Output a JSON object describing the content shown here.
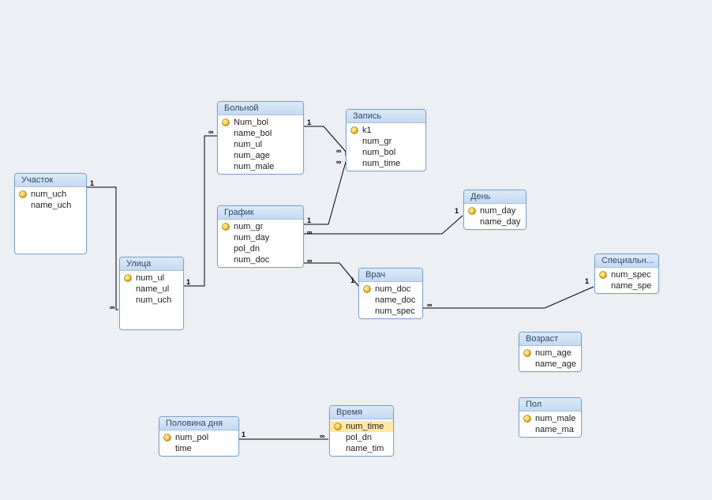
{
  "tables": {
    "uchastok": {
      "title": "Участок",
      "fields": [
        {
          "name": "num_uch",
          "pk": true
        },
        {
          "name": "name_uch",
          "pk": false
        }
      ]
    },
    "ulica": {
      "title": "Улица",
      "fields": [
        {
          "name": "num_ul",
          "pk": true
        },
        {
          "name": "name_ul",
          "pk": false
        },
        {
          "name": "num_uch",
          "pk": false
        }
      ]
    },
    "bolnoy": {
      "title": "Больной",
      "fields": [
        {
          "name": "Num_bol",
          "pk": true
        },
        {
          "name": "name_bol",
          "pk": false
        },
        {
          "name": "num_ul",
          "pk": false
        },
        {
          "name": "num_age",
          "pk": false
        },
        {
          "name": "num_male",
          "pk": false
        }
      ]
    },
    "grafik": {
      "title": "График",
      "fields": [
        {
          "name": "num_gr",
          "pk": true
        },
        {
          "name": "num_day",
          "pk": false
        },
        {
          "name": "pol_dn",
          "pk": false
        },
        {
          "name": "num_doc",
          "pk": false
        }
      ]
    },
    "zapis": {
      "title": "Запись",
      "fields": [
        {
          "name": "k1",
          "pk": true
        },
        {
          "name": "num_gr",
          "pk": false
        },
        {
          "name": "num_bol",
          "pk": false
        },
        {
          "name": "num_time",
          "pk": false
        }
      ]
    },
    "den": {
      "title": "День",
      "fields": [
        {
          "name": "num_day",
          "pk": true
        },
        {
          "name": "name_day",
          "pk": false
        }
      ]
    },
    "vrach": {
      "title": "Врач",
      "fields": [
        {
          "name": "num_doc",
          "pk": true
        },
        {
          "name": "name_doc",
          "pk": false
        },
        {
          "name": "num_spec",
          "pk": false
        }
      ]
    },
    "special": {
      "title": "Специальн...",
      "fields": [
        {
          "name": "num_spec",
          "pk": true
        },
        {
          "name": "name_spe",
          "pk": false
        }
      ]
    },
    "vozrast": {
      "title": "Возраст",
      "fields": [
        {
          "name": "num_age",
          "pk": true
        },
        {
          "name": "name_age",
          "pk": false
        }
      ]
    },
    "pol": {
      "title": "Пол",
      "fields": [
        {
          "name": "num_male",
          "pk": true
        },
        {
          "name": "name_ma",
          "pk": false
        }
      ]
    },
    "polovina": {
      "title": "Половина дня",
      "fields": [
        {
          "name": "num_pol",
          "pk": true
        },
        {
          "name": "time",
          "pk": false
        }
      ]
    },
    "vremya": {
      "title": "Время",
      "fields": [
        {
          "name": "num_time",
          "pk": true,
          "selected": true
        },
        {
          "name": "pol_dn",
          "pk": false
        },
        {
          "name": "name_tim",
          "pk": false
        }
      ]
    }
  },
  "labels": {
    "one": "1",
    "many": "∞"
  }
}
